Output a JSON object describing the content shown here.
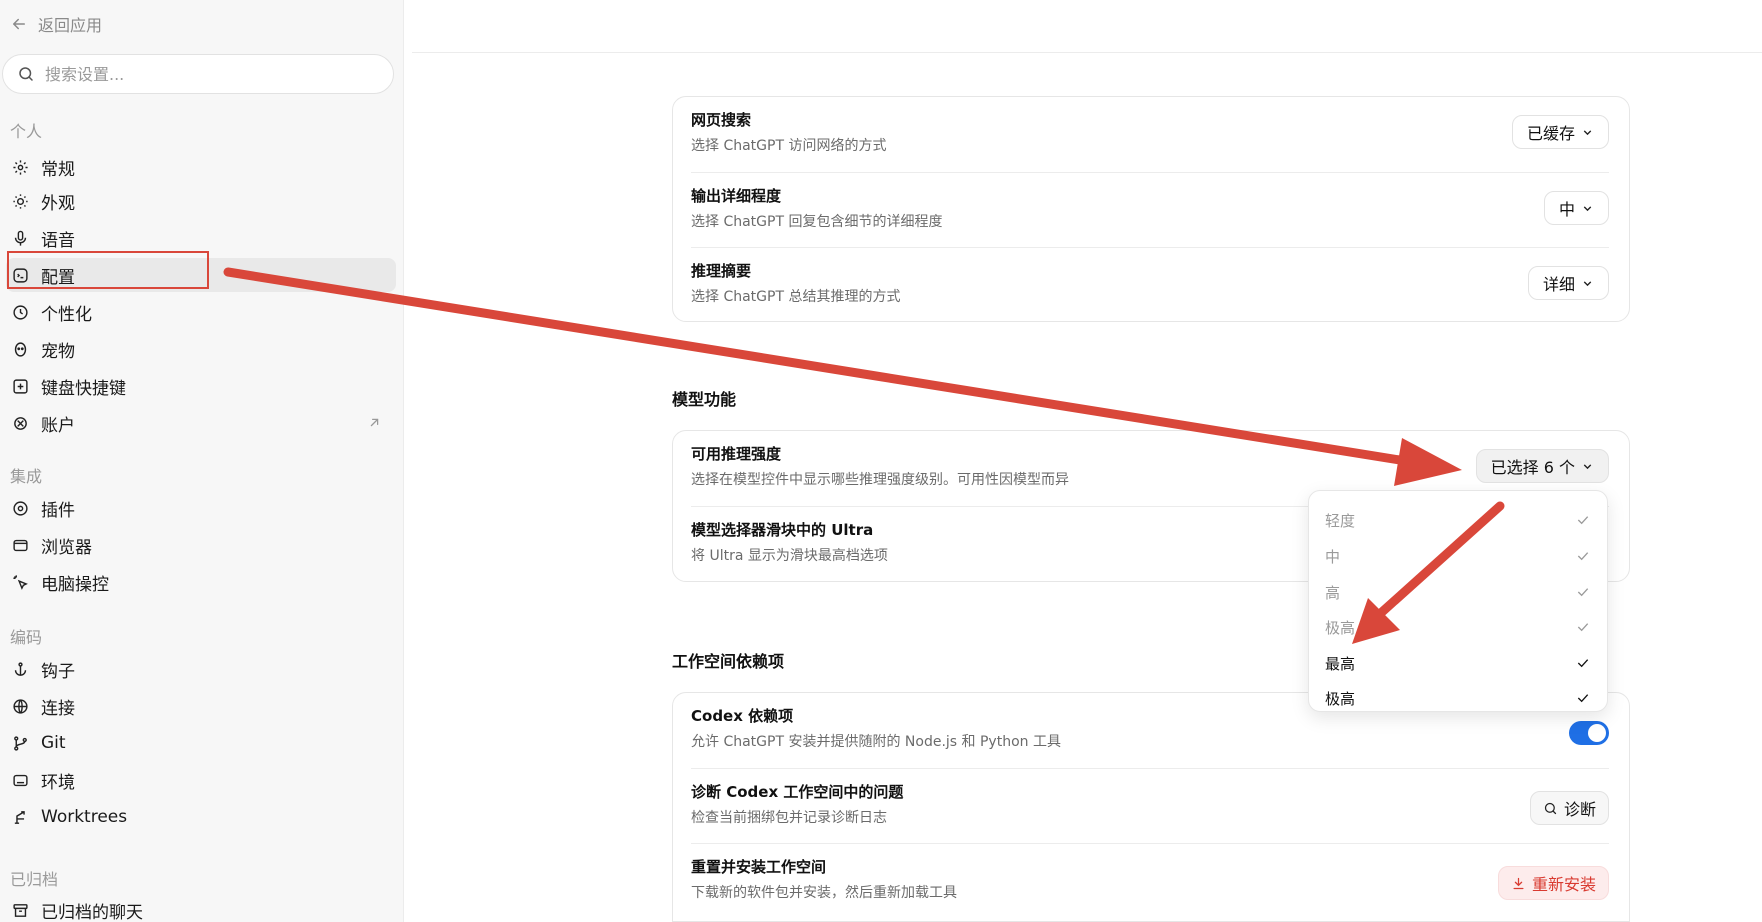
{
  "sidebar": {
    "back_label": "返回应用",
    "search_placeholder": "搜索设置...",
    "sections": {
      "personal": "个人",
      "integrations": "集成",
      "coding": "编码",
      "archived": "已归档"
    },
    "items": {
      "general": "常规",
      "appearance": "外观",
      "voice": "语音",
      "config": "配置",
      "personalization": "个性化",
      "pet": "宠物",
      "shortcuts": "键盘快捷键",
      "account": "账户",
      "plugins": "插件",
      "browser": "浏览器",
      "computer_use": "电脑操控",
      "hooks": "钩子",
      "connections": "连接",
      "git": "Git",
      "environments": "环境",
      "worktrees": "Worktrees",
      "archived_chats": "已归档的聊天"
    },
    "active_item": "配置"
  },
  "main": {
    "general_card": {
      "web_search": {
        "title": "网页搜索",
        "desc": "选择 ChatGPT 访问网络的方式",
        "value": "已缓存"
      },
      "verbosity": {
        "title": "输出详细程度",
        "desc": "选择 ChatGPT 回复包含细节的详细程度",
        "value": "中"
      },
      "reasoning_summary": {
        "title": "推理摘要",
        "desc": "选择 ChatGPT 总结其推理的方式",
        "value": "详细"
      }
    },
    "model_section": {
      "heading": "模型功能",
      "reasoning_effort": {
        "title": "可用推理强度",
        "desc": "选择在模型控件中显示哪些推理强度级别。可用性因模型而异",
        "value": "已选择 6 个"
      },
      "ultra_slider": {
        "title": "模型选择器滑块中的 Ultra",
        "desc": "将 Ultra 显示为滑块最高档选项"
      }
    },
    "workspace_section": {
      "heading": "工作空间依赖项",
      "codex_deps": {
        "title": "Codex 依赖项",
        "desc": "允许 ChatGPT 安装并提供随附的 Node.js 和 Python 工具",
        "enabled": true
      },
      "diagnose": {
        "title": "诊断 Codex 工作空间中的问题",
        "desc": "检查当前捆绑包并记录诊断日志",
        "button": "诊断"
      },
      "reinstall": {
        "title": "重置并安装工作空间",
        "desc": "下载新的软件包并安装，然后重新加载工具",
        "button": "重新安装"
      }
    },
    "effort_menu": {
      "options": [
        {
          "label": "轻度",
          "checked": true,
          "dimmed": true
        },
        {
          "label": "中",
          "checked": true,
          "dimmed": true
        },
        {
          "label": "高",
          "checked": true,
          "dimmed": true
        },
        {
          "label": "极高",
          "checked": true,
          "dimmed": true
        },
        {
          "label": "最高",
          "checked": true,
          "dimmed": false
        },
        {
          "label": "极高",
          "checked": true,
          "dimmed": false
        }
      ]
    }
  },
  "annotation_color": "#d9473a",
  "accent_color": "#1f6fe5"
}
